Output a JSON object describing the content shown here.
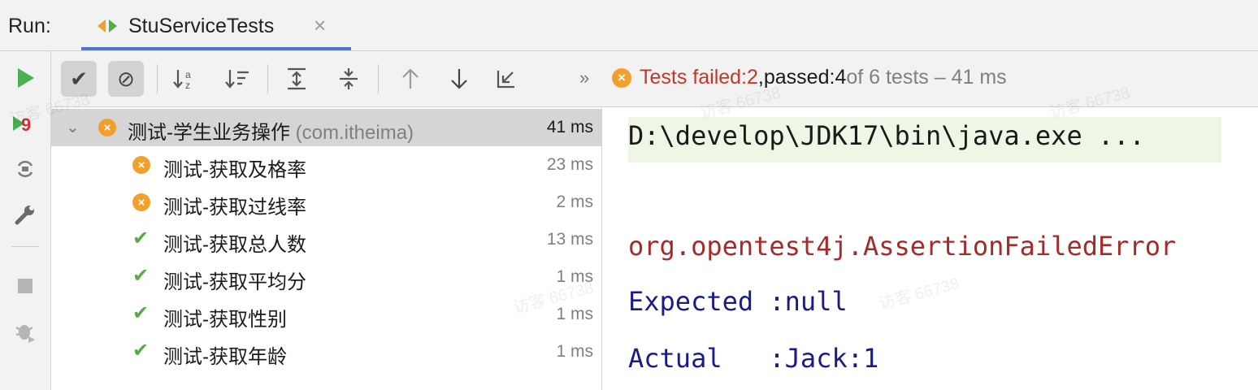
{
  "run_bar": {
    "label": "Run:",
    "tab_title": "StuServiceTests",
    "close_glyph": "×"
  },
  "toolbar": {
    "more": "»",
    "status": {
      "failed_prefix": "Tests failed: ",
      "failed_count": "2",
      "sep": ", ",
      "passed_prefix": "passed: ",
      "passed_count": "4",
      "suffix": " of 6 tests – 41 ms"
    }
  },
  "tree": {
    "root": {
      "name": "测试-学生业务操作",
      "package": "(com.itheima)",
      "time": "41 ms",
      "status": "failed"
    },
    "tests": [
      {
        "name": "测试-获取及格率",
        "time": "23 ms",
        "status": "failed"
      },
      {
        "name": "测试-获取过线率",
        "time": "2 ms",
        "status": "failed"
      },
      {
        "name": "测试-获取总人数",
        "time": "13 ms",
        "status": "passed"
      },
      {
        "name": "测试-获取平均分",
        "time": "1 ms",
        "status": "passed"
      },
      {
        "name": "测试-获取性别",
        "time": "1 ms",
        "status": "passed"
      },
      {
        "name": "测试-获取年龄",
        "time": "1 ms",
        "status": "passed"
      }
    ]
  },
  "console": {
    "command": "D:\\develop\\JDK17\\bin\\java.exe ...",
    "error": "org.opentest4j.AssertionFailedError",
    "expected_label": "Expected",
    "expected_value": ":null",
    "actual_label": "Actual",
    "actual_value": ":Jack:1"
  },
  "watermark": "访客 66738",
  "colors": {
    "failed": "#f29f2c",
    "passed": "#5aa84a",
    "run_green": "#4caf50",
    "rerun_red": "#d32f2f"
  }
}
